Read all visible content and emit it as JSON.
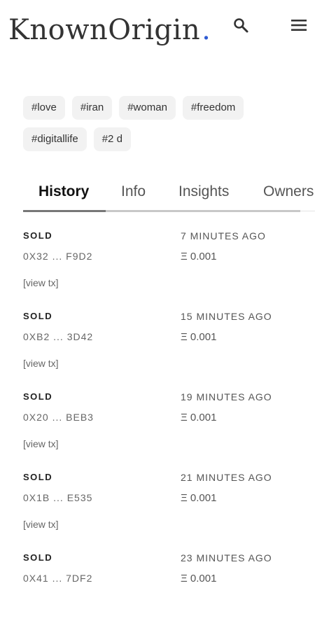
{
  "header": {
    "logo_text": "KnownOrigin",
    "logo_dot": ".",
    "icons": {
      "search": "search-icon",
      "menu": "hamburger-menu-icon"
    },
    "accent_color": "#2f5bd3"
  },
  "tags": {
    "row1": [
      "#love",
      "#iran",
      "#woman",
      "#freedom"
    ],
    "row2": [
      "#digitallife",
      "#2 d"
    ]
  },
  "tabs": {
    "items": [
      "History",
      "Info",
      "Insights",
      "Owners"
    ],
    "active": "History"
  },
  "history": [
    {
      "status": "SOLD",
      "time": "7 MINUTES AGO",
      "address": "0X32 ... F9D2",
      "price": "Ξ 0.001",
      "link": "[view tx]"
    },
    {
      "status": "SOLD",
      "time": "15 MINUTES AGO",
      "address": "0XB2 ... 3D42",
      "price": "Ξ 0.001",
      "link": "[view tx]"
    },
    {
      "status": "SOLD",
      "time": "19 MINUTES AGO",
      "address": "0X20 ... BEB3",
      "price": "Ξ 0.001",
      "link": "[view tx]"
    },
    {
      "status": "SOLD",
      "time": "21 MINUTES AGO",
      "address": "0X1B ... E535",
      "price": "Ξ 0.001",
      "link": "[view tx]"
    },
    {
      "status": "SOLD",
      "time": "23 MINUTES AGO",
      "address": "0X41 ... 7DF2",
      "price": "Ξ 0.001"
    }
  ]
}
